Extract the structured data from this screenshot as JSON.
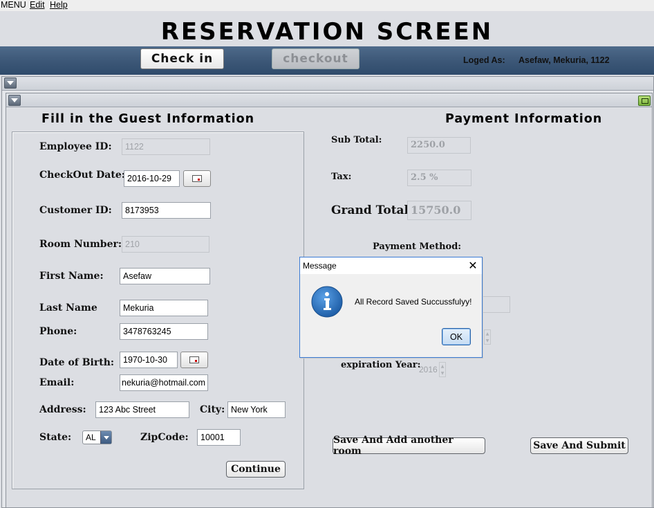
{
  "menu": {
    "items": [
      {
        "label": "MENU"
      },
      {
        "label": "Edit"
      },
      {
        "label": "Help"
      }
    ]
  },
  "header": {
    "title": "RESERVATION SCREEN",
    "checkin_label": "Check in",
    "checkout_label": "checkout",
    "loged_as_label": "Loged As:",
    "loged_user": "Asefaw, Mekuria, 1122"
  },
  "guest": {
    "section_title": "Fill in the Guest Information",
    "employee_id_label": "Employee ID:",
    "employee_id_value": "1122",
    "checkout_date_label": "CheckOut Date:",
    "checkout_date_value": "2016-10-29",
    "customer_id_label": "Customer ID:",
    "customer_id_value": "8173953",
    "room_number_label": "Room Number:",
    "room_number_value": "210",
    "first_name_label": "First Name:",
    "first_name_value": "Asefaw",
    "last_name_label": "Last Name",
    "last_name_value": "Mekuria",
    "phone_label": "Phone:",
    "phone_value": "3478763245",
    "dob_label": "Date of Birth:",
    "dob_value": "1970-10-30",
    "email_label": "Email:",
    "email_value": "nekuria@hotmail.com",
    "address_label": "Address:",
    "address_value": "123 Abc Street",
    "city_label": "City:",
    "city_value": "New York",
    "state_label": "State:",
    "state_value": "AL",
    "zip_label": "ZipCode:",
    "zip_value": "10001",
    "continue_label": "Continue"
  },
  "payment": {
    "section_title": "Payment Information",
    "subtotal_label": "Sub Total:",
    "subtotal_value": "2250.0",
    "tax_label": "Tax:",
    "tax_value": "2.5 %",
    "grand_total_label": "Grand Total:",
    "grand_total_value": "15750.0",
    "payment_method_label": "Payment Method:",
    "expiration_year_label": "expiration Year:",
    "expiration_year_value": "2016",
    "save_add_room_label": "Save And Add another room",
    "save_submit_label": "Save And Submit"
  },
  "dialog": {
    "title": "Message",
    "close_glyph": "✕",
    "message": "All Record Saved Succussfulyy!",
    "ok_label": "OK",
    "icon": "info-icon"
  },
  "colors": {
    "header_band": "#3d5878",
    "background": "#dcdee3",
    "dialog_border": "#3a7bd5",
    "info_icon": "#1f5fa8"
  }
}
